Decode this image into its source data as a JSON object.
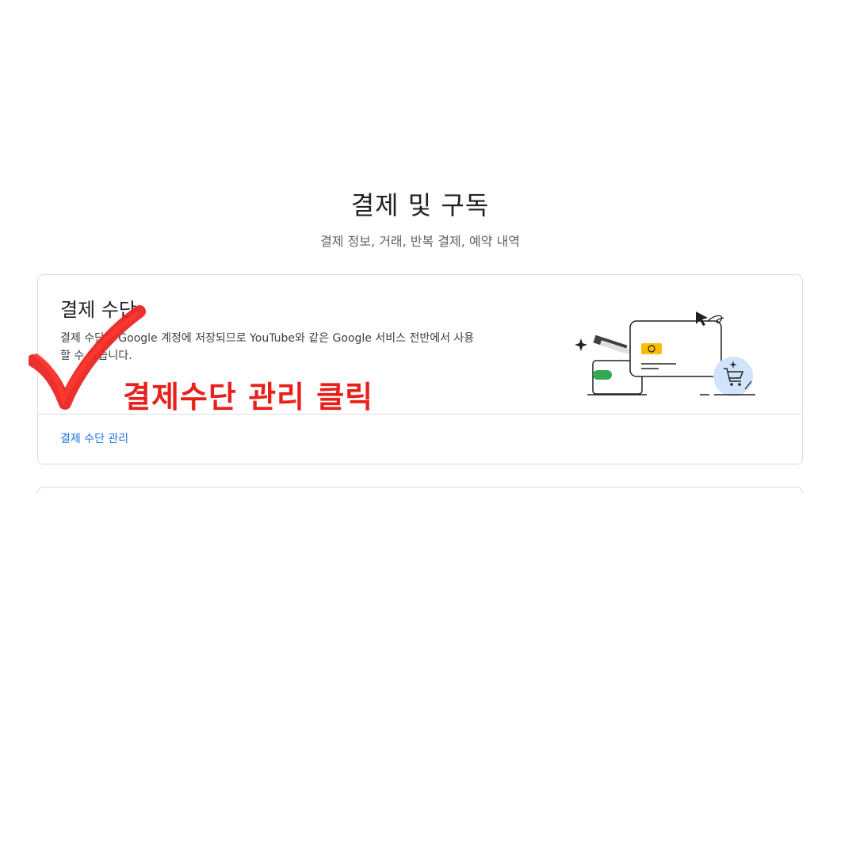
{
  "header": {
    "title": "결제 및 구독",
    "subtitle": "결제 정보, 거래, 반복 결제, 예약 내역"
  },
  "payment_card": {
    "title": "결제 수단",
    "description": "결제 수단은 Google 계정에 저장되므로 YouTube와 같은 Google 서비스 전반에서 사용할 수 있습니다.",
    "link_label": "결제 수단 관리"
  },
  "annotation": {
    "text": "결제수단 관리 클릭",
    "color": "#e8201c"
  },
  "colors": {
    "link": "#1a73e8",
    "border": "#dadce0",
    "accent_yellow": "#fbbc04",
    "accent_green": "#34a853",
    "accent_blue_light": "#d2e3fc"
  },
  "icons": {
    "check": "checkmark-icon",
    "illustration": "payment-illustration-icon"
  }
}
